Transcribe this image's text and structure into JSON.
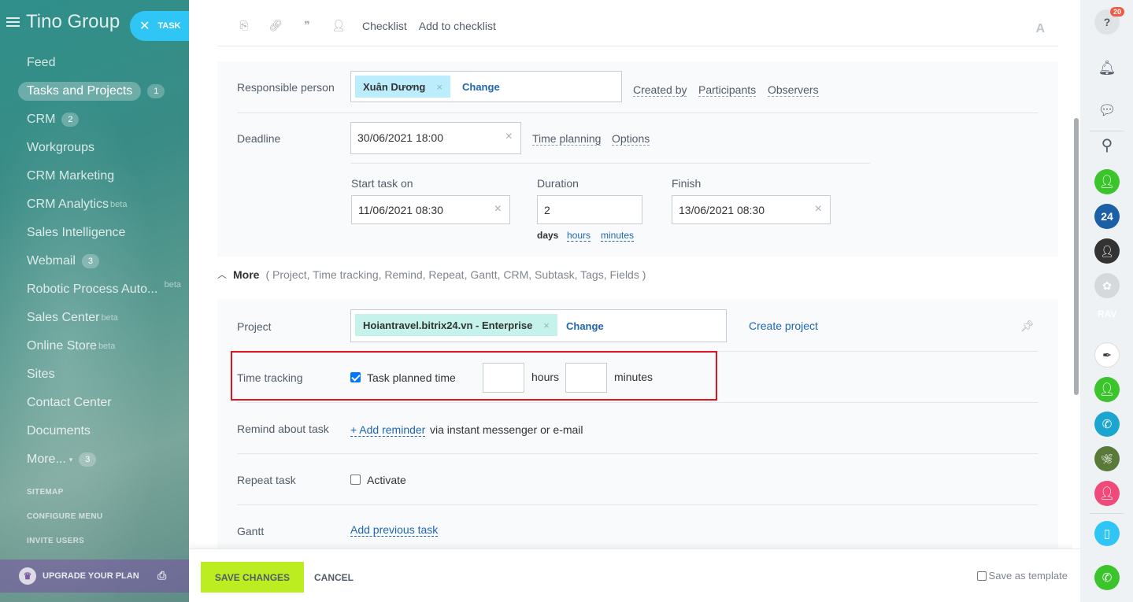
{
  "sidebar": {
    "brand": "Tino Group",
    "task_pill": "TASK",
    "items": [
      {
        "label": "Feed",
        "badge": "",
        "beta": ""
      },
      {
        "label": "Tasks and Projects",
        "badge": "1",
        "beta": ""
      },
      {
        "label": "CRM",
        "badge": "2",
        "beta": ""
      },
      {
        "label": "Workgroups",
        "badge": "",
        "beta": ""
      },
      {
        "label": "CRM Marketing",
        "badge": "",
        "beta": ""
      },
      {
        "label": "CRM Analytics",
        "badge": "",
        "beta": "beta"
      },
      {
        "label": "Sales Intelligence",
        "badge": "",
        "beta": ""
      },
      {
        "label": "Webmail",
        "badge": "3",
        "beta": ""
      },
      {
        "label": "Robotic Process Auto...",
        "badge": "",
        "beta": "beta"
      },
      {
        "label": "Sales Center",
        "badge": "",
        "beta": "beta"
      },
      {
        "label": "Online Store",
        "badge": "",
        "beta": "beta"
      },
      {
        "label": "Sites",
        "badge": "",
        "beta": ""
      },
      {
        "label": "Contact Center",
        "badge": "",
        "beta": ""
      },
      {
        "label": "Documents",
        "badge": "",
        "beta": ""
      },
      {
        "label": "More...",
        "badge": "3",
        "beta": ""
      }
    ],
    "sitemap": "SITEMAP",
    "configure_menu": "CONFIGURE MENU",
    "invite_users": "INVITE USERS",
    "upgrade": "UPGRADE YOUR PLAN"
  },
  "toolbar": {
    "checklist": "Checklist",
    "add_to_checklist": "Add to checklist",
    "font_icon": "A"
  },
  "form": {
    "responsible": {
      "label": "Responsible person",
      "chip": "Xuân Dương",
      "chip_remove": "×",
      "change": "Change",
      "created_by": "Created by",
      "participants": "Participants",
      "observers": "Observers"
    },
    "deadline": {
      "label": "Deadline",
      "value": "30/06/2021 18:00",
      "clear": "×",
      "time_planning": "Time planning",
      "options": "Options"
    },
    "start": {
      "label": "Start task on",
      "value": "11/06/2021 08:30",
      "clear": "×"
    },
    "duration": {
      "label": "Duration",
      "value": "2",
      "days": "days",
      "hours": "hours",
      "minutes": "minutes"
    },
    "finish": {
      "label": "Finish",
      "value": "13/06/2021 08:30",
      "clear": "×"
    },
    "more": {
      "label": "More",
      "list": "( Project,  Time tracking,  Remind,  Repeat,  Gantt,  CRM,  Subtask,  Tags,  Fields )"
    },
    "project": {
      "label": "Project",
      "chip": "Hoiantravel.bitrix24.vn - Enterprise",
      "chip_remove": "×",
      "change": "Change",
      "create": "Create project"
    },
    "time_tracking": {
      "label": "Time tracking",
      "checkbox_label": "Task planned time",
      "checked": true,
      "hours_label": "hours",
      "minutes_label": "minutes",
      "hours_value": "",
      "minutes_value": ""
    },
    "remind": {
      "label": "Remind about task",
      "add": "+ Add reminder",
      "suffix": "via instant messenger or e-mail"
    },
    "repeat": {
      "label": "Repeat task",
      "checkbox_label": "Activate"
    },
    "gantt": {
      "label": "Gantt",
      "add": "Add previous task"
    }
  },
  "footer": {
    "save": "SAVE CHANGES",
    "cancel": "CANCEL",
    "save_template": "Save as template"
  },
  "rightbar": {
    "help_badge": "20",
    "b24_label": "24",
    "rav_label": "RAV",
    "icons": [
      "help-icon",
      "bell-icon",
      "chat-icon",
      "search-icon",
      "contact-icon",
      "b24-icon",
      "avatar-icon",
      "phone-icon",
      "mobile-icon",
      "call-icon"
    ]
  },
  "colors": {
    "accent": "#2fc6f6",
    "save_button": "#bbed21",
    "highlight": "#e0141e",
    "link": "#2067b0"
  }
}
